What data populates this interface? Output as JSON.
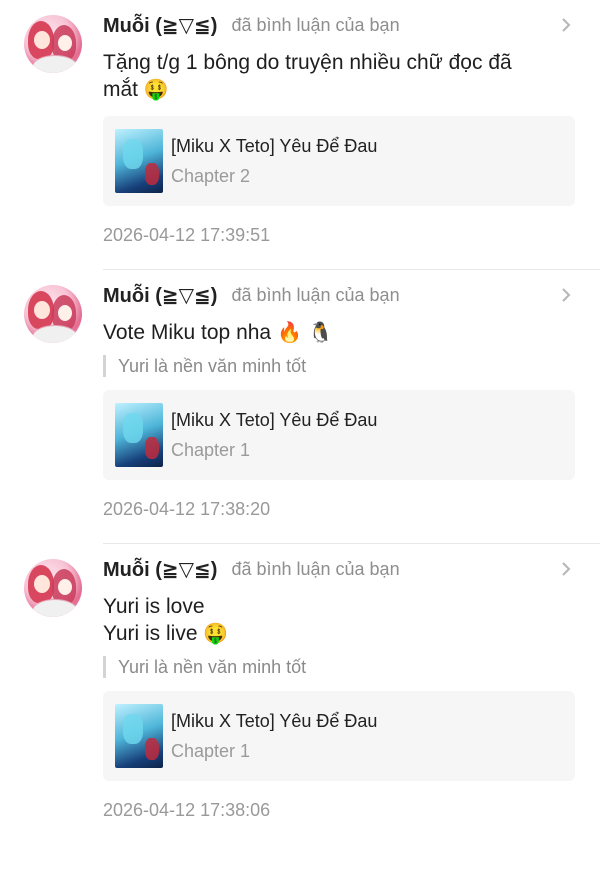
{
  "action_text": "đã bình luận của bạn",
  "notifications": [
    {
      "username": "Muỗi (≧▽≦)",
      "lines": [
        "Tặng t/g 1 bông do truyện nhiều chữ đọc đã",
        "mắt"
      ],
      "emoji": "🤑",
      "quote": "",
      "card_title": "[Miku X Teto] Yêu Để Đau",
      "card_chapter": "Chapter 2",
      "timestamp": "2026-04-12 17:39:51"
    },
    {
      "username": "Muỗi (≧▽≦)",
      "lines": [
        "Vote Miku top nha"
      ],
      "emoji": "🔥 🐧",
      "quote": "Yuri là nền văn minh tốt",
      "card_title": "[Miku X Teto] Yêu Để Đau",
      "card_chapter": "Chapter 1",
      "timestamp": "2026-04-12 17:38:20"
    },
    {
      "username": "Muỗi (≧▽≦)",
      "lines": [
        "Yuri is love",
        "Yuri is live"
      ],
      "emoji": "🤑",
      "quote": "Yuri là nền văn minh tốt",
      "card_title": "[Miku X Teto] Yêu Để Đau",
      "card_chapter": "Chapter 1",
      "timestamp": "2026-04-12 17:38:06"
    }
  ]
}
